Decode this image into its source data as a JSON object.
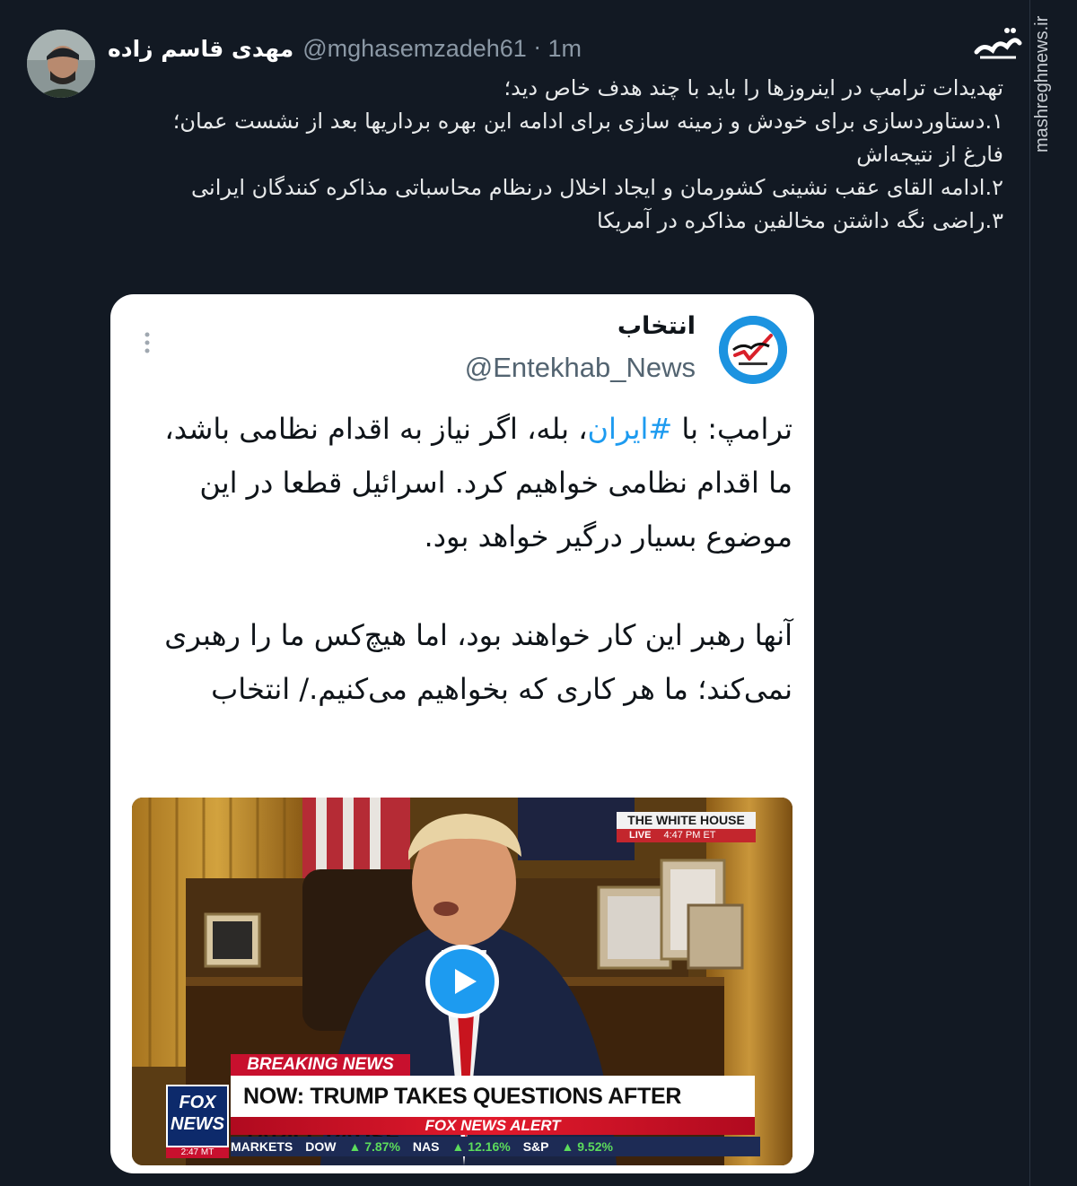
{
  "post": {
    "author_name": "مهدی قاسم زاده",
    "author_handle": "@mghasemzadeh61",
    "separator": "·",
    "time": "1m",
    "lines": [
      "تهدیدات ترامپ در اینروزها را باید با چند هدف خاص دید؛",
      "۱.دستاوردسازی برای خودش و زمینه سازی برای ادامه این بهره برداریها بعد از نشست عمان؛ فارغ از نتیجه‌اش",
      "۲.ادامه القای عقب نشینی کشورمان و ایجاد اخلال درنظام محاسباتی مذاکره کنندگان ایرانی",
      "۳.راضی نگه داشتن مخالفین مذاکره در آمریکا"
    ]
  },
  "watermark": {
    "site": "mashreghnews.ir",
    "logo_text": "مشرق"
  },
  "quote": {
    "name": "انتخاب",
    "handle": "@Entekhab_News",
    "avatar_text": "انتخاب",
    "para1_prefix": "ترامپ: با ",
    "hashtag": "#ایران",
    "para1_suffix": "، بله، اگر نیاز به اقدام نظامی باشد، ما اقدام نظامی خواهیم کرد. اسرائیل قطعا در این موضوع بسیار درگیر خواهد بود.",
    "para2": "آنها رهبر این کار خواهند بود، اما هیچ‌کس ما را رهبری نمی‌کند؛ ما هر کاری که بخواهیم می‌کنیم./ انتخاب"
  },
  "video": {
    "wh_title": "THE WHITE HOUSE",
    "wh_live": "LIVE",
    "wh_time": "4:47 PM ET",
    "breaking": "BREAKING NEWS",
    "headline": "NOW: TRUMP TAKES QUESTIONS AFTER TARIFF PAUSE",
    "alert": "FOX NEWS ALERT",
    "logo_text": "FOX NEWS",
    "logo_time": "2:47 MT",
    "ticker": {
      "markets": "MARKETS",
      "dow": "DOW",
      "dow_val": "▲ 7.87%",
      "nas": "NAS",
      "nas_val": "▲ 12.16%",
      "sp": "S&P",
      "sp_val": "▲ 9.52%"
    }
  }
}
